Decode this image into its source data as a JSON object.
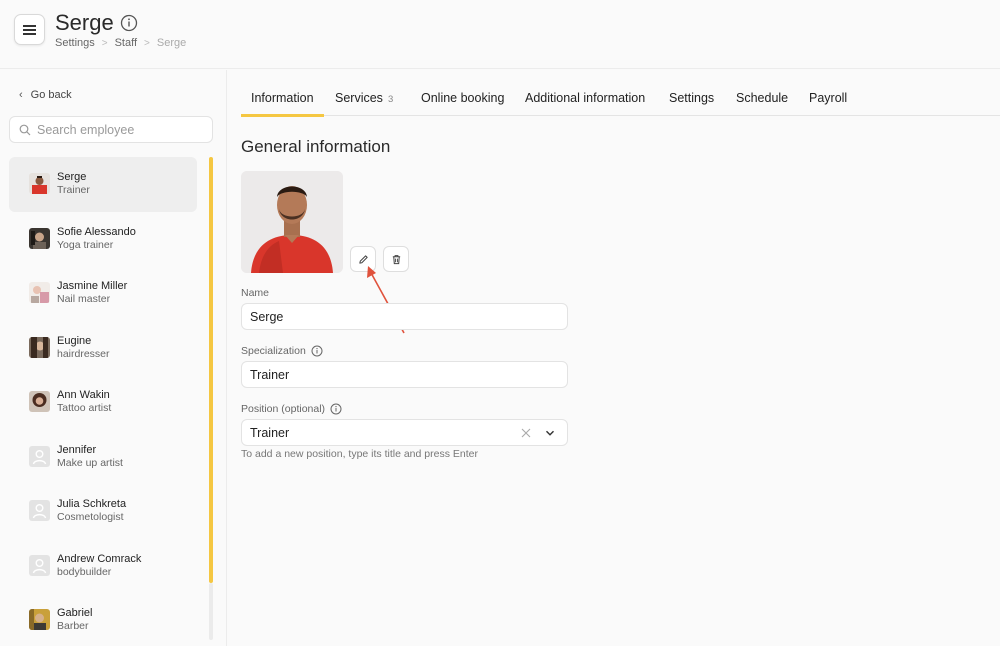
{
  "header": {
    "title": "Serge",
    "info_icon": "info-circle-icon",
    "menu_icon": "hamburger-menu-icon",
    "breadcrumb": [
      "Settings",
      "Staff",
      "Serge"
    ]
  },
  "sidebar": {
    "go_back": "Go back",
    "search_placeholder": "Search employee",
    "employees": [
      {
        "name": "Serge",
        "role": "Trainer",
        "active": true,
        "avatar": "photo-red"
      },
      {
        "name": "Sofie Alessando",
        "role": "Yoga trainer",
        "avatar": "photo-dark"
      },
      {
        "name": "Jasmine Miller",
        "role": "Nail master",
        "avatar": "photo-light"
      },
      {
        "name": "Eugine",
        "role": "hairdresser",
        "avatar": "photo-brown"
      },
      {
        "name": "Ann Wakin",
        "role": "Tattoo artist",
        "avatar": "photo-hair"
      },
      {
        "name": "Jennifer",
        "role": "Make up artist",
        "avatar": "placeholder"
      },
      {
        "name": "Julia Schkreta",
        "role": "Cosmetologist",
        "avatar": "placeholder"
      },
      {
        "name": "Andrew Comrack",
        "role": "bodybuilder",
        "avatar": "placeholder"
      },
      {
        "name": "Gabriel",
        "role": "Barber",
        "avatar": "photo-gold"
      }
    ]
  },
  "tabs": [
    {
      "label": "Information",
      "active": true
    },
    {
      "label": "Services",
      "count": "3"
    },
    {
      "label": "Online booking"
    },
    {
      "label": "Additional information"
    },
    {
      "label": "Settings"
    },
    {
      "label": "Schedule"
    },
    {
      "label": "Payroll"
    }
  ],
  "main": {
    "section_title": "General information",
    "edit_icon": "pencil-icon",
    "delete_icon": "trash-icon",
    "name_label": "Name",
    "name_value": "Serge",
    "specialization_label": "Specialization",
    "specialization_value": "Trainer",
    "position_label": "Position (optional)",
    "position_value": "Trainer",
    "position_hint": "To add a new position, type its title and press Enter"
  },
  "colors": {
    "accent": "#f5c742",
    "arrow": "#e0523c",
    "shirt": "#d9362b"
  }
}
